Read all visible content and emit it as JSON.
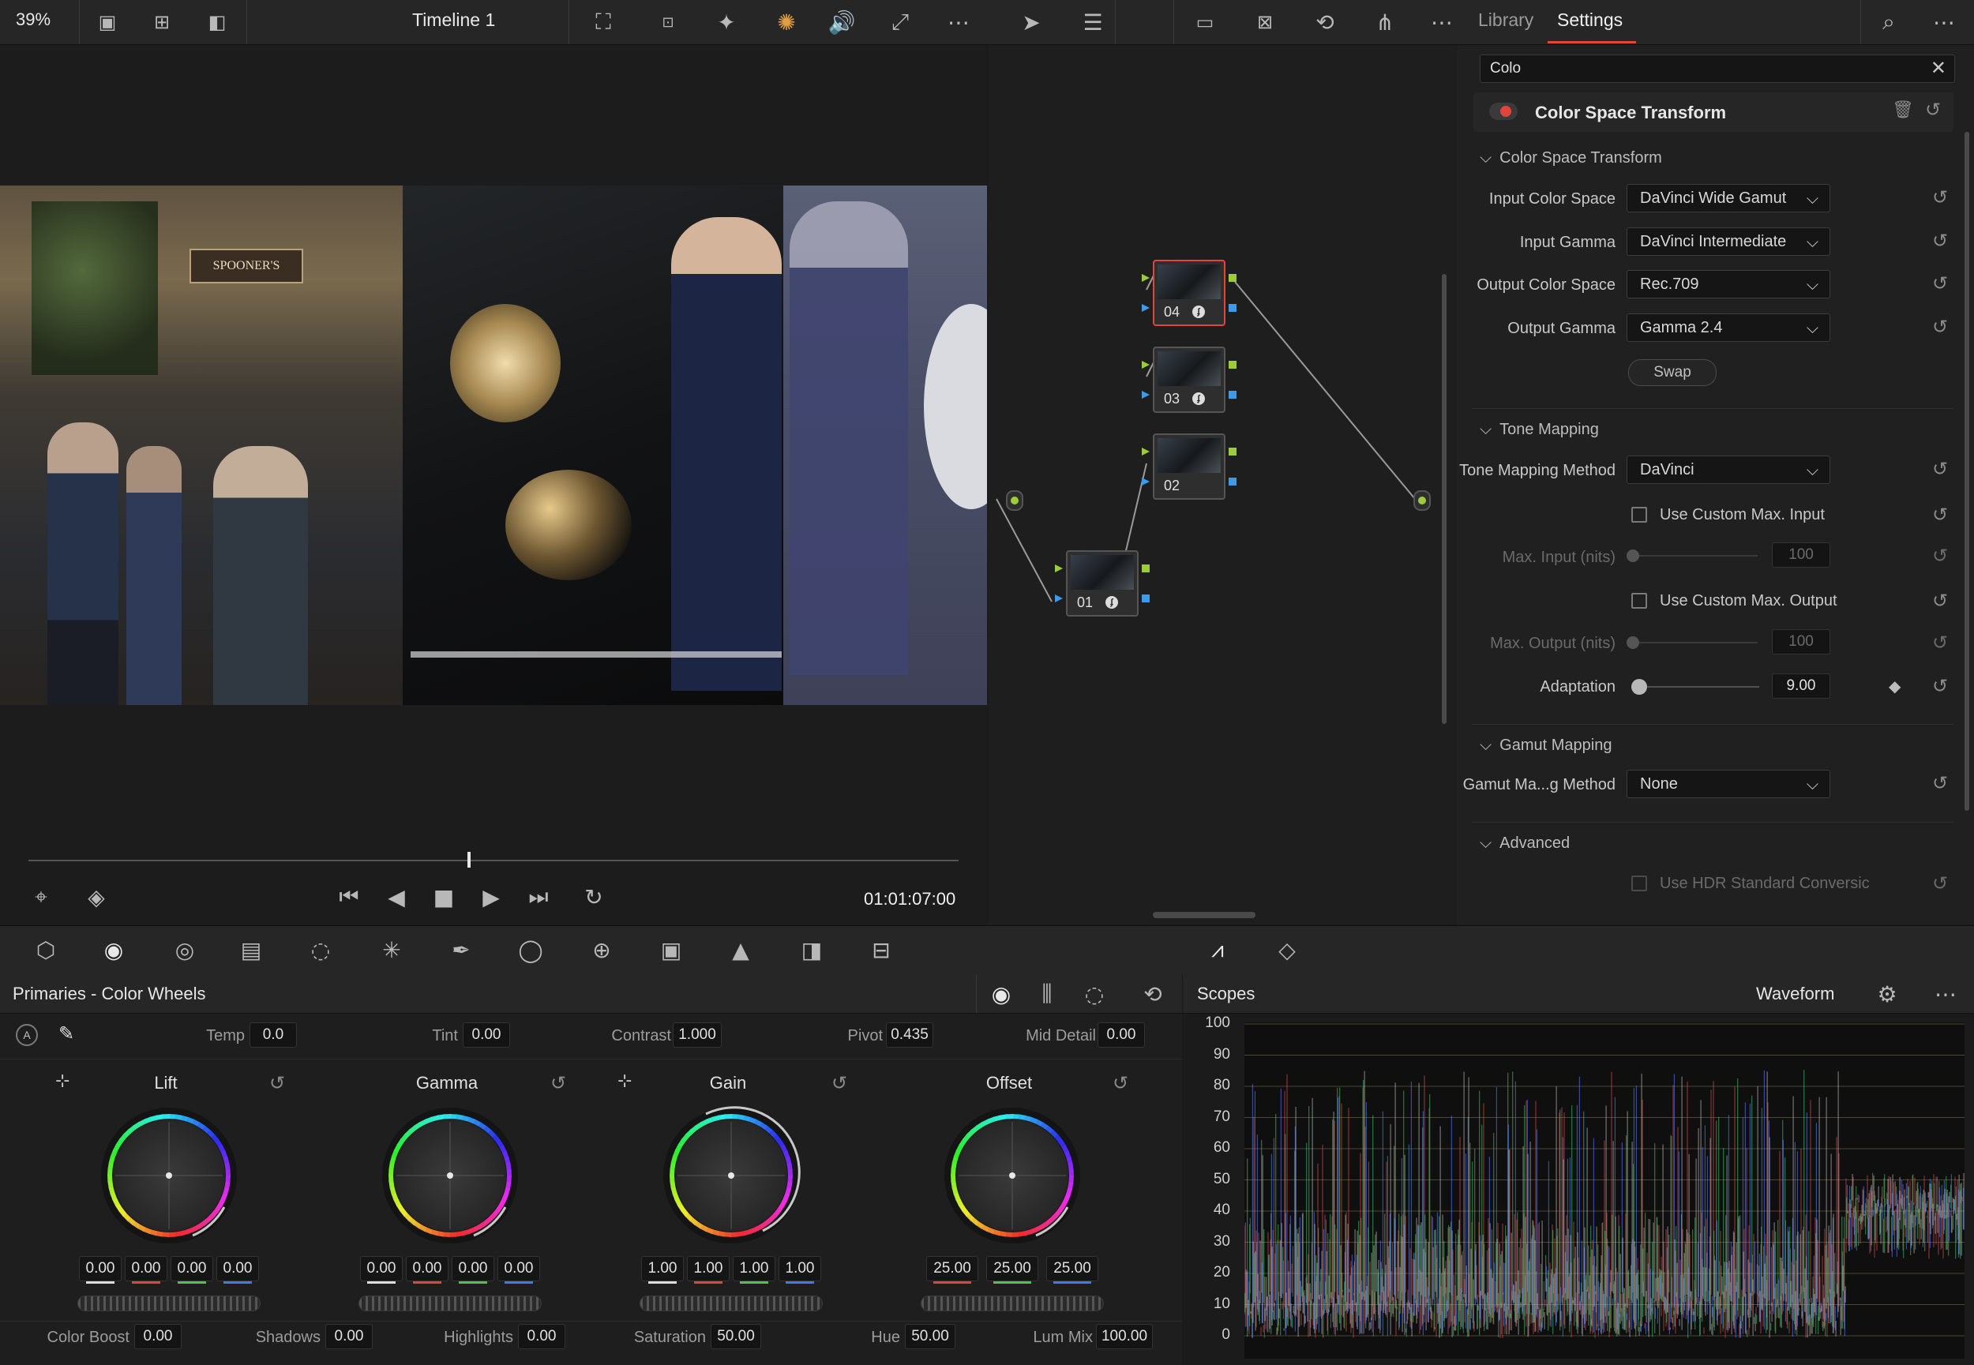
{
  "viewer": {
    "zoom": "39%",
    "timeline_name": "Timeline 1",
    "timecode": "01:01:07:00"
  },
  "inspector": {
    "tabs": [
      "Library",
      "Settings"
    ],
    "active_tab": "Settings",
    "search_value": "Colo",
    "effect_title": "Color Space Transform",
    "sections": {
      "cst": "Color Space Transform",
      "tone": "Tone Mapping",
      "gamut": "Gamut Mapping",
      "advanced": "Advanced"
    },
    "fields": {
      "input_cs_label": "Input Color Space",
      "input_cs_value": "DaVinci Wide Gamut",
      "input_gamma_label": "Input Gamma",
      "input_gamma_value": "DaVinci Intermediate",
      "output_cs_label": "Output Color Space",
      "output_cs_value": "Rec.709",
      "output_gamma_label": "Output Gamma",
      "output_gamma_value": "Gamma 2.4",
      "swap_label": "Swap",
      "tm_method_label": "Tone Mapping Method",
      "tm_method_value": "DaVinci",
      "custom_max_input_label": "Use Custom Max. Input",
      "max_input_label": "Max. Input (nits)",
      "max_input_value": "100",
      "custom_max_output_label": "Use Custom Max. Output",
      "max_output_label": "Max. Output (nits)",
      "max_output_value": "100",
      "adaptation_label": "Adaptation",
      "adaptation_value": "9.00",
      "gamut_method_label": "Gamut Ma...g Method",
      "gamut_method_value": "None",
      "hdr_conv_label": "Use HDR Standard Conversic"
    }
  },
  "nodes": [
    {
      "id": "04",
      "fx": true,
      "selected": true
    },
    {
      "id": "03",
      "fx": true,
      "selected": false
    },
    {
      "id": "02",
      "fx": false,
      "selected": false
    },
    {
      "id": "01",
      "fx": true,
      "selected": false
    }
  ],
  "primaries": {
    "title": "Primaries - Color Wheels",
    "top": {
      "temp_label": "Temp",
      "temp_value": "0.0",
      "tint_label": "Tint",
      "tint_value": "0.00",
      "contrast_label": "Contrast",
      "contrast_value": "1.000",
      "pivot_label": "Pivot",
      "pivot_value": "0.435",
      "middetail_label": "Mid Detail",
      "middetail_value": "0.00"
    },
    "wheels": [
      {
        "name": "Lift",
        "values": [
          "0.00",
          "0.00",
          "0.00",
          "0.00"
        ]
      },
      {
        "name": "Gamma",
        "values": [
          "0.00",
          "0.00",
          "0.00",
          "0.00"
        ]
      },
      {
        "name": "Gain",
        "values": [
          "1.00",
          "1.00",
          "1.00",
          "1.00"
        ]
      },
      {
        "name": "Offset",
        "values": [
          "25.00",
          "25.00",
          "25.00"
        ]
      }
    ],
    "bottom": {
      "colorboost_label": "Color Boost",
      "colorboost_value": "0.00",
      "shadows_label": "Shadows",
      "shadows_value": "0.00",
      "highlights_label": "Highlights",
      "highlights_value": "0.00",
      "saturation_label": "Saturation",
      "saturation_value": "50.00",
      "hue_label": "Hue",
      "hue_value": "50.00",
      "lummix_label": "Lum Mix",
      "lummix_value": "100.00"
    }
  },
  "scopes": {
    "title": "Scopes",
    "mode": "Waveform",
    "y_ticks": [
      "100",
      "90",
      "80",
      "70",
      "60",
      "50",
      "40",
      "30",
      "20",
      "10",
      "0"
    ]
  },
  "colors": {
    "accent_red": "#e0443a",
    "highlight": "#e3453b",
    "node_port_green": "#9ccc3c",
    "node_port_blue": "#3d9be9"
  }
}
